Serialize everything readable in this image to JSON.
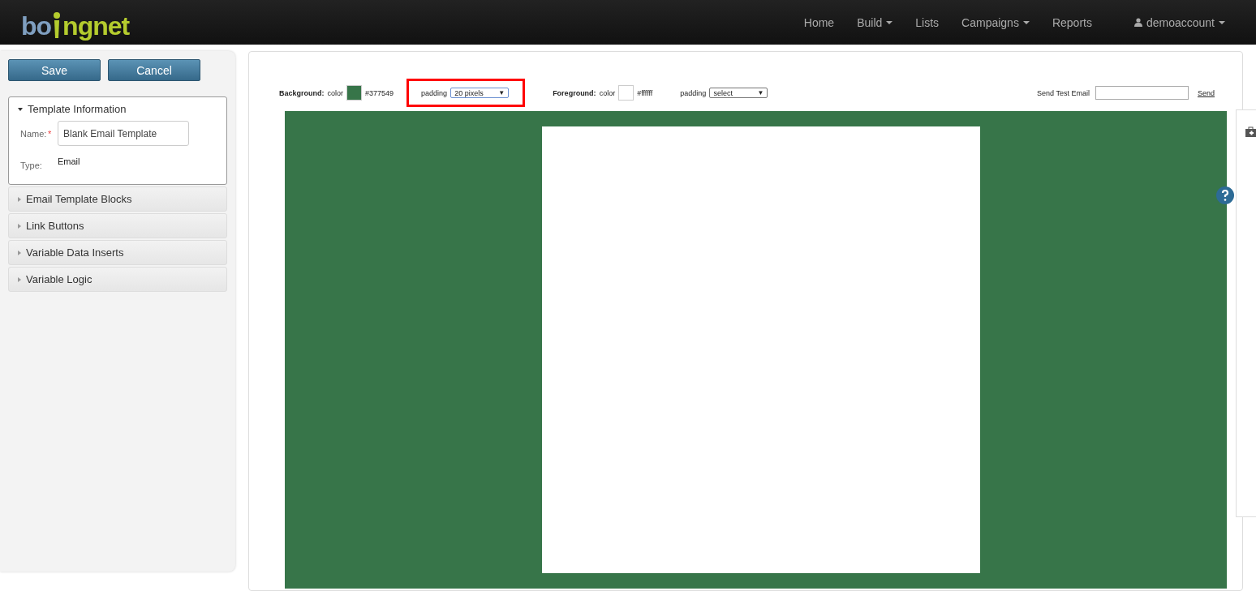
{
  "logo": {
    "part_1": "bo",
    "part_2": "ngnet"
  },
  "nav": {
    "items": [
      {
        "label": "Home",
        "dropdown": false
      },
      {
        "label": "Build",
        "dropdown": true
      },
      {
        "label": "Lists",
        "dropdown": false
      },
      {
        "label": "Campaigns",
        "dropdown": true
      },
      {
        "label": "Reports",
        "dropdown": false
      }
    ],
    "account": {
      "label": "demoaccount",
      "dropdown": true
    }
  },
  "sidebar": {
    "buttons": [
      "Save",
      "Cancel"
    ],
    "sections": [
      {
        "title": "Template Information",
        "expanded": true,
        "required_mark": "*",
        "fields": [
          {
            "label": "Name:",
            "required": true,
            "kind": "input",
            "value": "Blank Email Template"
          },
          {
            "label": "Type:",
            "required": false,
            "kind": "text",
            "value": "Email"
          }
        ]
      },
      {
        "title": "Email Template Blocks",
        "expanded": false
      },
      {
        "title": "Link Buttons",
        "expanded": false
      },
      {
        "title": "Variable Data Inserts",
        "expanded": false
      },
      {
        "title": "Variable Logic",
        "expanded": false
      }
    ]
  },
  "toolbar": {
    "background": {
      "heading": "Background:",
      "color_label": "color",
      "color": "#377549",
      "hex": "#377549",
      "padding_label": "padding",
      "padding_value": "20 pixels",
      "arrow": "▼",
      "padding_highlighted": true
    },
    "foreground": {
      "heading": "Foreground:",
      "color_label": "color",
      "color": "#ffffff",
      "hex": "#ffffff",
      "padding_label": "padding",
      "padding_value": "select",
      "arrow": "▼",
      "padding_highlighted": false
    },
    "send_test": {
      "label": "Send Test Email",
      "link": "Send"
    }
  }
}
